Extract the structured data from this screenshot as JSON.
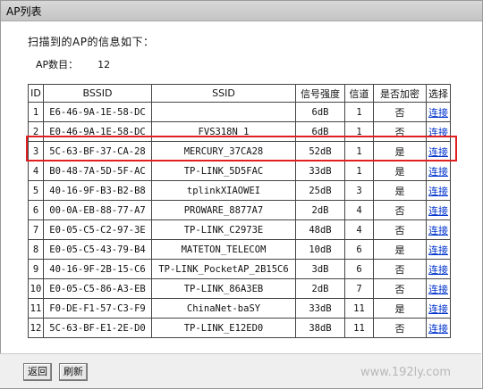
{
  "title": "AP列表",
  "heading": "扫描到的AP的信息如下：",
  "count_label": "AP数目：",
  "count_value": "12",
  "columns": [
    "ID",
    "BSSID",
    "SSID",
    "信号强度",
    "信道",
    "是否加密",
    "选择"
  ],
  "rows": [
    {
      "id": "1",
      "bssid": "E6-46-9A-1E-58-DC",
      "ssid": "",
      "signal": "6dB",
      "channel": "1",
      "encrypted": "否",
      "select": "连接"
    },
    {
      "id": "2",
      "bssid": "E0-46-9A-1E-58-DC",
      "ssid": "FVS318N_1",
      "signal": "6dB",
      "channel": "1",
      "encrypted": "否",
      "select": "连接"
    },
    {
      "id": "3",
      "bssid": "5C-63-BF-37-CA-28",
      "ssid": "MERCURY_37CA28",
      "signal": "52dB",
      "channel": "1",
      "encrypted": "是",
      "select": "连接"
    },
    {
      "id": "4",
      "bssid": "B0-48-7A-5D-5F-AC",
      "ssid": "TP-LINK_5D5FAC",
      "signal": "33dB",
      "channel": "1",
      "encrypted": "是",
      "select": "连接"
    },
    {
      "id": "5",
      "bssid": "40-16-9F-B3-B2-B8",
      "ssid": "tplinkXIAOWEI",
      "signal": "25dB",
      "channel": "3",
      "encrypted": "是",
      "select": "连接"
    },
    {
      "id": "6",
      "bssid": "00-0A-EB-88-77-A7",
      "ssid": "PROWARE_8877A7",
      "signal": "2dB",
      "channel": "4",
      "encrypted": "否",
      "select": "连接"
    },
    {
      "id": "7",
      "bssid": "E0-05-C5-C2-97-3E",
      "ssid": "TP-LINK_C2973E",
      "signal": "48dB",
      "channel": "4",
      "encrypted": "否",
      "select": "连接"
    },
    {
      "id": "8",
      "bssid": "E0-05-C5-43-79-B4",
      "ssid": "MATETON_TELECOM",
      "signal": "10dB",
      "channel": "6",
      "encrypted": "是",
      "select": "连接"
    },
    {
      "id": "9",
      "bssid": "40-16-9F-2B-15-C6",
      "ssid": "TP-LINK_PocketAP_2B15C6",
      "signal": "3dB",
      "channel": "6",
      "encrypted": "否",
      "select": "连接"
    },
    {
      "id": "10",
      "bssid": "E0-05-C5-86-A3-EB",
      "ssid": "TP-LINK_86A3EB",
      "signal": "2dB",
      "channel": "7",
      "encrypted": "否",
      "select": "连接"
    },
    {
      "id": "11",
      "bssid": "F0-DE-F1-57-C3-F9",
      "ssid": "ChinaNet-baSY",
      "signal": "33dB",
      "channel": "11",
      "encrypted": "是",
      "select": "连接"
    },
    {
      "id": "12",
      "bssid": "5C-63-BF-E1-2E-D0",
      "ssid": "TP-LINK_E12ED0",
      "signal": "38dB",
      "channel": "11",
      "encrypted": "否",
      "select": "连接"
    }
  ],
  "buttons": {
    "back": "返回",
    "refresh": "刷新"
  },
  "watermark": "www.192ly.com",
  "highlight_color": "#e02020",
  "link_color": "#0033cc"
}
